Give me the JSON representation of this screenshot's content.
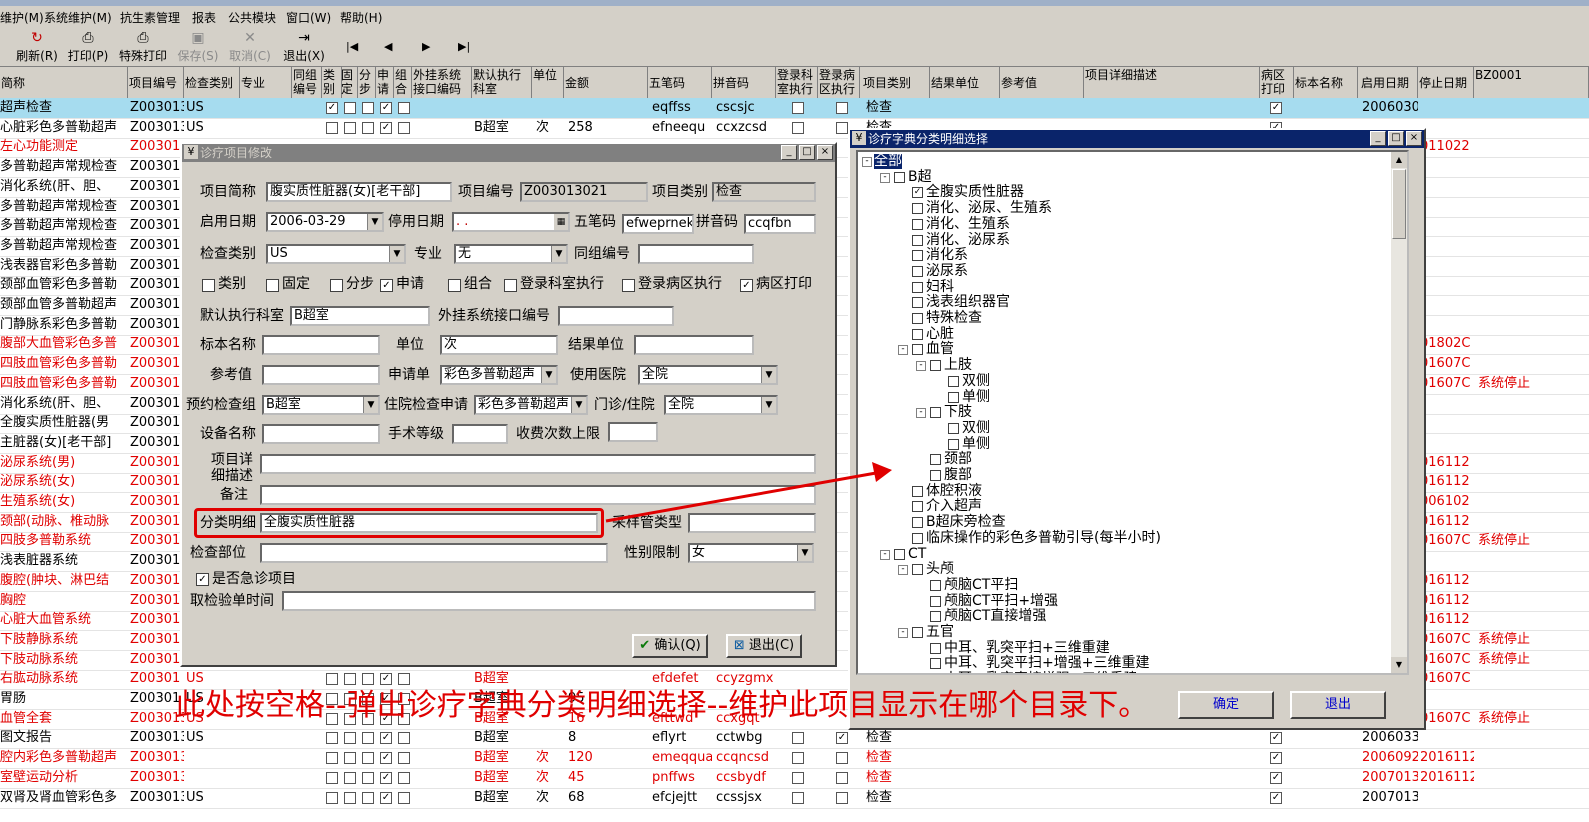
{
  "menu": [
    "维护(M)",
    "系统维护(M)",
    "抗生素管理",
    "报表",
    "公共模块",
    "窗口(W)",
    "帮助(H)"
  ],
  "toolbar": {
    "refresh": "刷新(R)",
    "print": "打印(P)",
    "special_print": "特殊打印",
    "save": "保存(S)",
    "cancel": "取消(C)",
    "exit": "退出(X)",
    "first": "|◀",
    "prev": "◀",
    "next": "▶",
    "last": "▶|"
  },
  "grid": {
    "headers": [
      "简称",
      "项目编号",
      "检查类别",
      "专业",
      "同组编号",
      "类别",
      "固定",
      "分步",
      "申请",
      "组合",
      "外挂系统接口编码",
      "默认执行科室",
      "单位",
      "金额",
      "五笔码",
      "拼音码",
      "登录科室执行",
      "登录病区执行",
      "项目类别",
      "结果单位",
      "参考值",
      "项目详细描述",
      "病区打印",
      "标本名称",
      "启用日期",
      "停止日期",
      "BZ0001"
    ],
    "rows": [
      {
        "name": "超声检查",
        "code": "Z003013",
        "type": "US",
        "dept": "",
        "unit": "",
        "amount": "",
        "wb": "eqffss",
        "py": "cscsjc",
        "cat": "检查",
        "start": "2006030",
        "stop": "",
        "note": "",
        "red": false,
        "sel": true,
        "cb": [
          1,
          0,
          0,
          1,
          0
        ],
        "dk": 0,
        "dw": 0,
        "wp": 1
      },
      {
        "name": "心脏彩色多普勒超声",
        "code": "Z003013",
        "type": "US",
        "dept": "B超室",
        "unit": "次",
        "amount": "258",
        "wb": "efneequ",
        "py": "ccxzcsd",
        "cat": "检查",
        "start": "",
        "stop": "",
        "note": "",
        "red": false,
        "sel": false,
        "cb": [
          0,
          0,
          0,
          1,
          0
        ],
        "dk": 0,
        "dw": 0,
        "wp": 1
      },
      {
        "name": "左心功能测定",
        "code": "Z00301",
        "type": "",
        "dept": "",
        "unit": "",
        "amount": "",
        "wb": "",
        "py": "",
        "cat": "",
        "start": "",
        "stop": "011022",
        "note": "",
        "red": true
      },
      {
        "name": "多普勒超声常规检查",
        "code": "Z00301",
        "red": false
      },
      {
        "name": "消化系统(肝、胆、",
        "code": "Z00301",
        "red": false
      },
      {
        "name": "多普勒超声常规检查",
        "code": "Z00301",
        "red": false
      },
      {
        "name": "多普勒超声常规检查",
        "code": "Z00301",
        "red": false
      },
      {
        "name": "多普勒超声常规检查",
        "code": "Z00301",
        "red": false
      },
      {
        "name": "浅表器官彩色多普勒",
        "code": "Z00301",
        "red": false
      },
      {
        "name": "颈部血管彩色多普勒",
        "code": "Z00301",
        "red": false
      },
      {
        "name": "颈部血管多普勒超声",
        "code": "Z00301",
        "red": false
      },
      {
        "name": "门静脉系彩色多普勒",
        "code": "Z00301",
        "red": false
      },
      {
        "name": "腹部大血管彩色多普",
        "code": "Z00301",
        "stop": "01802C",
        "red": true
      },
      {
        "name": "四肢血管彩色多普勒",
        "code": "Z00301",
        "stop": "01607C",
        "red": true
      },
      {
        "name": "四肢血管彩色多普勒",
        "code": "Z00301",
        "stop": "01607C",
        "note": "系统停止",
        "red": true
      },
      {
        "name": "消化系统(肝、胆、",
        "code": "Z00301",
        "red": false
      },
      {
        "name": "全腹实质性脏器(男",
        "code": "Z00301",
        "red": false
      },
      {
        "name": "主脏器(女)[老干部]",
        "code": "Z00301",
        "red": false
      },
      {
        "name": "泌尿系统(男)",
        "code": "Z00301",
        "stop": "016112",
        "red": true
      },
      {
        "name": "泌尿系统(女)",
        "code": "Z00301",
        "stop": "016112",
        "red": true
      },
      {
        "name": "生殖系统(女)",
        "code": "Z00301",
        "stop": "006102",
        "red": true
      },
      {
        "name": "颈部(动脉、椎动脉",
        "code": "Z00301",
        "stop": "016112",
        "red": true
      },
      {
        "name": "四肢多普勒系统",
        "code": "Z00301",
        "stop": "01607C",
        "note": "系统停止",
        "red": true
      },
      {
        "name": "浅表脏器系统",
        "code": "Z00301",
        "red": false
      },
      {
        "name": "腹腔(肿块、淋巴结",
        "code": "Z00301",
        "stop": "016112",
        "red": true
      },
      {
        "name": "胸腔",
        "code": "Z00301",
        "stop": "016112",
        "red": true
      },
      {
        "name": "心脏大血管系统",
        "code": "Z00301",
        "stop": "016112",
        "red": true
      },
      {
        "name": "下肢静脉系统",
        "code": "Z00301",
        "stop": "01607C",
        "note": "系统停止",
        "red": true
      },
      {
        "name": "下肢动脉系统",
        "code": "Z00301",
        "stop": "01607C",
        "note": "系统停止",
        "red": true
      },
      {
        "name": "右肱动脉系统",
        "code": "Z00301",
        "type": "US",
        "dept": "B超室",
        "wb": "efdefet",
        "py": "ccyzgmx",
        "stop": "01607C",
        "red": true,
        "cb": [
          0,
          0,
          0,
          1,
          0
        ]
      },
      {
        "name": "胃肠",
        "code": "Z00301",
        "type": "US",
        "dept": "B超室",
        "amount": "95",
        "red": false,
        "cb": [
          0,
          0,
          0,
          1,
          0
        ]
      },
      {
        "name": "血管全套",
        "code": "Z003013",
        "type": "US",
        "dept": "B超室",
        "amount": "16",
        "wb": "efttwd",
        "py": "ccxgqt",
        "stop": "01607C",
        "note": "系统停止",
        "red": true,
        "cb": [
          0,
          0,
          0,
          1,
          0
        ]
      },
      {
        "name": "图文报告",
        "code": "Z003013",
        "type": "US",
        "dept": "B超室",
        "amount": "8",
        "wb": "eflyrt",
        "py": "cctwbg",
        "cat": "检查",
        "start": "2006033",
        "red": false,
        "cb": [
          0,
          0,
          0,
          1,
          0
        ],
        "dk": 0,
        "dw": 1,
        "wp": 1
      },
      {
        "name": "腔内彩色多普勒超声",
        "code": "Z003013",
        "type": "",
        "dept": "B超室",
        "unit": "次",
        "amount": "120",
        "wb": "emeqquaf",
        "py": "ccqncsd",
        "cat": "检查",
        "start": "2006092",
        "stop": "2016112",
        "red": true,
        "cb": [
          0,
          0,
          0,
          1,
          0
        ],
        "dk": 0,
        "dw": 0,
        "wp": 1
      },
      {
        "name": "室壁运动分析",
        "code": "Z003013",
        "type": "",
        "dept": "B超室",
        "unit": "次",
        "amount": "45",
        "wb": "pnffws",
        "py": "ccsbydf",
        "cat": "检查",
        "start": "2007013",
        "stop": "2016112",
        "red": true,
        "cb": [
          0,
          0,
          0,
          1,
          0
        ],
        "dk": 0,
        "dw": 0,
        "wp": 1
      },
      {
        "name": "双肾及肾血管彩色多",
        "code": "Z003013",
        "type": "US",
        "dept": "B超室",
        "unit": "次",
        "amount": "68",
        "wb": "efcjejtt",
        "py": "ccssjsx",
        "cat": "检查",
        "start": "2007013",
        "red": false,
        "cb": [
          0,
          0,
          0,
          1,
          0
        ],
        "dk": 0,
        "dw": 0,
        "wp": 1
      }
    ]
  },
  "edit_dialog": {
    "title": "诊疗项目修改",
    "labels": {
      "short_name": "项目简称",
      "item_code": "项目编号",
      "item_cat": "项目类别",
      "start_date": "启用日期",
      "stop_date": "停用日期",
      "wubi": "五笔码",
      "pinyin": "拼音码",
      "check_type": "检查类别",
      "specialty": "专业",
      "group_no": "同组编号",
      "exec_dept": "默认执行科室",
      "ext_code": "外挂系统接口编号",
      "specimen": "标本名称",
      "unit": "单位",
      "result_unit": "结果单位",
      "ref_value": "参考值",
      "request_form": "申请单",
      "hospital": "使用医院",
      "appt_group": "预约检查组",
      "inpatient_req": "住院检查申请",
      "outpatient": "门诊/住院",
      "device": "设备名称",
      "surgery_level": "手术等级",
      "charge_limit": "收费次数上限",
      "detail": "项目详细描述",
      "remark": "备注",
      "classification": "分类明细",
      "tube_type": "采样管类型",
      "body_part": "检查部位",
      "gender": "性别限制",
      "emergency": "是否急诊项目",
      "fetch_time": "取检验单时间"
    },
    "values": {
      "short_name": "腹实质性脏器(女)[老干部]",
      "item_code": "Z003013021",
      "item_cat": "检查",
      "start_date": "2006-03-29",
      "stop_date": "  .  .  ",
      "wubi": "efweprnek",
      "pinyin": "ccqfbn",
      "check_type": "US",
      "specialty": "无",
      "group_no": "",
      "exec_dept": "B超室",
      "ext_code": "",
      "specimen": "",
      "unit": "次",
      "result_unit": "",
      "ref_value": "",
      "request_form": "彩色多普勒超声",
      "hospital": "全院",
      "appt_group": "B超室",
      "inpatient_req": "彩色多普勒超声",
      "outpatient": "全院",
      "device": "",
      "surgery_level": "",
      "charge_limit": "",
      "detail": "",
      "remark": "",
      "classification": "全腹实质性脏器",
      "tube_type": "",
      "body_part": "",
      "gender": "女",
      "fetch_time": ""
    },
    "checks": [
      {
        "label": "类别",
        "checked": false
      },
      {
        "label": "固定",
        "checked": false
      },
      {
        "label": "分步",
        "checked": false
      },
      {
        "label": "申请",
        "checked": true
      },
      {
        "label": "组合",
        "checked": false
      },
      {
        "label": "登录科室执行",
        "checked": false
      },
      {
        "label": "登录病区执行",
        "checked": false
      },
      {
        "label": "病区打印",
        "checked": true
      }
    ],
    "emergency_checked": true,
    "ok": "确认(Q)",
    "exit": "退出(C)"
  },
  "tree_dialog": {
    "title": "诊疗字典分类明细选择",
    "nodes": [
      {
        "t": "全部",
        "lv": 0,
        "exp": "-",
        "cb": false,
        "sel": true
      },
      {
        "t": "B超",
        "lv": 1,
        "exp": "-",
        "cb": true,
        "on": false
      },
      {
        "t": "全腹实质性脏器",
        "lv": 2,
        "cb": true,
        "on": true
      },
      {
        "t": "消化、泌尿、生殖系",
        "lv": 2,
        "cb": true,
        "on": false
      },
      {
        "t": "消化、生殖系",
        "lv": 2,
        "cb": true,
        "on": false
      },
      {
        "t": "消化、泌尿系",
        "lv": 2,
        "cb": true,
        "on": false
      },
      {
        "t": "消化系",
        "lv": 2,
        "cb": true,
        "on": false
      },
      {
        "t": "泌尿系",
        "lv": 2,
        "cb": true,
        "on": false
      },
      {
        "t": "妇科",
        "lv": 2,
        "cb": true,
        "on": false
      },
      {
        "t": "浅表组织器官",
        "lv": 2,
        "cb": true,
        "on": false
      },
      {
        "t": "特殊检查",
        "lv": 2,
        "cb": true,
        "on": false
      },
      {
        "t": "心脏",
        "lv": 2,
        "cb": true,
        "on": false
      },
      {
        "t": "血管",
        "lv": 2,
        "exp": "-",
        "cb": true,
        "on": false
      },
      {
        "t": "上肢",
        "lv": 3,
        "exp": "-",
        "cb": true,
        "on": false
      },
      {
        "t": "双侧",
        "lv": 4,
        "cb": true,
        "on": false
      },
      {
        "t": "单侧",
        "lv": 4,
        "cb": true,
        "on": false
      },
      {
        "t": "下肢",
        "lv": 3,
        "exp": "-",
        "cb": true,
        "on": false
      },
      {
        "t": "双侧",
        "lv": 4,
        "cb": true,
        "on": false
      },
      {
        "t": "单侧",
        "lv": 4,
        "cb": true,
        "on": false
      },
      {
        "t": "颈部",
        "lv": 3,
        "cb": true,
        "on": false
      },
      {
        "t": "腹部",
        "lv": 3,
        "cb": true,
        "on": false
      },
      {
        "t": "体腔积液",
        "lv": 2,
        "cb": true,
        "on": false
      },
      {
        "t": "介入超声",
        "lv": 2,
        "cb": true,
        "on": false
      },
      {
        "t": "B超床旁检查",
        "lv": 2,
        "cb": true,
        "on": false
      },
      {
        "t": "临床操作的彩色多普勒引导(每半小时)",
        "lv": 2,
        "cb": true,
        "on": false
      },
      {
        "t": "CT",
        "lv": 1,
        "exp": "-",
        "cb": true,
        "on": false
      },
      {
        "t": "头颅",
        "lv": 2,
        "exp": "-",
        "cb": true,
        "on": false
      },
      {
        "t": "颅脑CT平扫",
        "lv": 3,
        "cb": true,
        "on": false
      },
      {
        "t": "颅脑CT平扫+增强",
        "lv": 3,
        "cb": true,
        "on": false
      },
      {
        "t": "颅脑CT直接增强",
        "lv": 3,
        "cb": true,
        "on": false
      },
      {
        "t": "五官",
        "lv": 2,
        "exp": "-",
        "cb": true,
        "on": false
      },
      {
        "t": "中耳、乳突平扫+三维重建",
        "lv": 3,
        "cb": true,
        "on": false
      },
      {
        "t": "中耳、乳突平扫+增强+三维重建",
        "lv": 3,
        "cb": true,
        "on": false
      },
      {
        "t": "中耳、乳突直接增强+三维重建",
        "lv": 3,
        "cb": true,
        "on": false
      }
    ],
    "ok": "确定",
    "exit": "退出"
  },
  "annotation": "此处按空格--弹出诊疗字典分类明细选择--维护此项目显示在哪个目录下。",
  "colors": {
    "highlight": "#e00000",
    "selected_row": "#a6dcef"
  }
}
